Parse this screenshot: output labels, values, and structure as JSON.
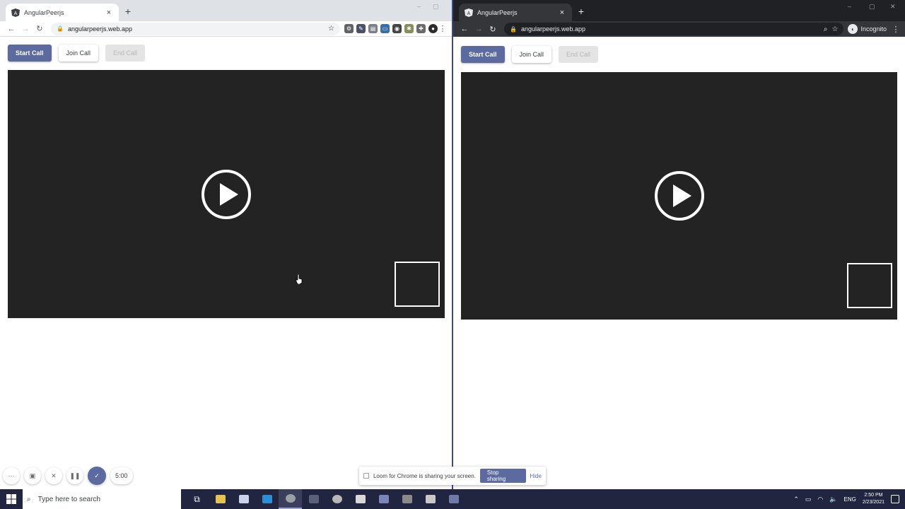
{
  "windows": {
    "left": {
      "tab_title": "AngularPeerjs",
      "url": "angularpeerjs.web.app",
      "buttons": {
        "start": "Start Call",
        "join": "Join Call",
        "end": "End Call"
      }
    },
    "right": {
      "tab_title": "AngularPeerjs",
      "url": "angularpeerjs.web.app",
      "profile_label": "Incognito",
      "buttons": {
        "start": "Start Call",
        "join": "Join Call",
        "end": "End Call"
      }
    }
  },
  "loom": {
    "timer": "5:00",
    "share_message": "Loom for Chrome is sharing your screen.",
    "stop_label": "Stop sharing",
    "hide_label": "Hide"
  },
  "taskbar": {
    "search_placeholder": "Type here to search",
    "language": "ENG",
    "time": "2:50 PM",
    "date": "2/23/2021"
  },
  "colors": {
    "primary": "#5c6aa0",
    "video_bg": "#232323",
    "taskbar": "#22253f"
  }
}
